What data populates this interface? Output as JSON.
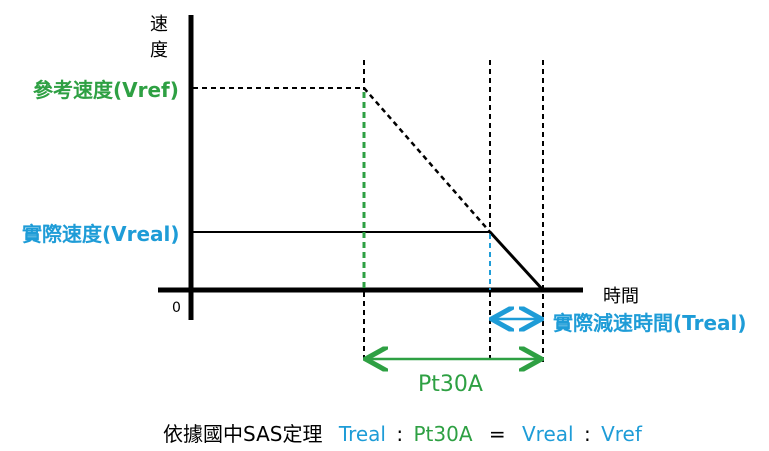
{
  "axes": {
    "y_label_line1": "速",
    "y_label_line2": "度",
    "x_label": "時間",
    "origin_label": "0"
  },
  "labels": {
    "v_ref": "參考速度(Vref)",
    "v_real": "實際速度(Vreal)",
    "t_real": "實際減速時間(Treal)",
    "pt30a": "Pt30A"
  },
  "formula": {
    "prefix": "依據國中SAS定理",
    "t_real": "Treal",
    "colon1": ":",
    "pt30a": "Pt30A",
    "equals": "=",
    "v_real": "Vreal",
    "colon2": ":",
    "v_ref": "Vref"
  },
  "colors": {
    "black": "#000000",
    "green": "#2EA043",
    "blue": "#1E9CD7"
  }
}
